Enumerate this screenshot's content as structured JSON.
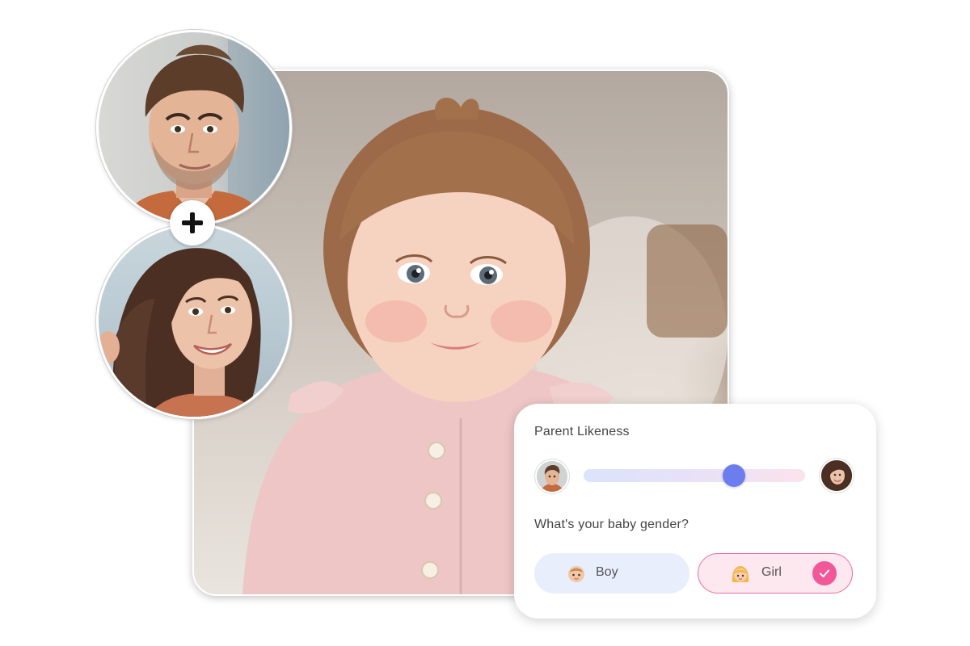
{
  "images": {
    "baby_photo": "baby-photo",
    "father_photo": "father-portrait",
    "mother_photo": "mother-portrait"
  },
  "icons": {
    "plus": "plus-icon",
    "check": "check-icon",
    "boy": "boy-face-emoji",
    "girl": "girl-face-emoji"
  },
  "panel": {
    "title": "Parent Likeness",
    "slider": {
      "value": 0.68,
      "left_avatar": "father-avatar",
      "right_avatar": "mother-avatar"
    },
    "question": "What's your baby gender?",
    "options": [
      {
        "label": "Boy",
        "selected": false
      },
      {
        "label": "Girl",
        "selected": true
      }
    ]
  },
  "colors": {
    "slider_thumb": "#6c7df0",
    "boy_bg": "#e8eefc",
    "girl_bg": "#fde8ef",
    "girl_border": "#f06aa0",
    "check_bg": "#f2579a"
  }
}
